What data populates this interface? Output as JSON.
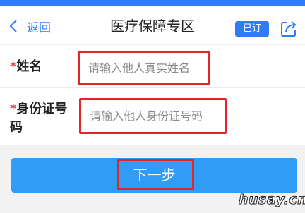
{
  "header": {
    "back_label": "返回",
    "title": "医疗保障专区",
    "subscribed_badge": "已订",
    "back_icon": "chevron-left-icon",
    "share_icon": "share-icon"
  },
  "form": {
    "required_mark": "*",
    "name_field": {
      "label": "姓名",
      "placeholder": "请输入他人真实姓名",
      "value": ""
    },
    "id_field": {
      "label": "身份证号码",
      "placeholder": "请输入他人身份证号码",
      "value": ""
    }
  },
  "next_button": {
    "label": "下一步"
  },
  "watermark": "husay.cn",
  "colors": {
    "accent": "#2f7cf6",
    "button": "#2f9cf5",
    "highlight": "#e0262b",
    "required": "#e23b3b"
  }
}
